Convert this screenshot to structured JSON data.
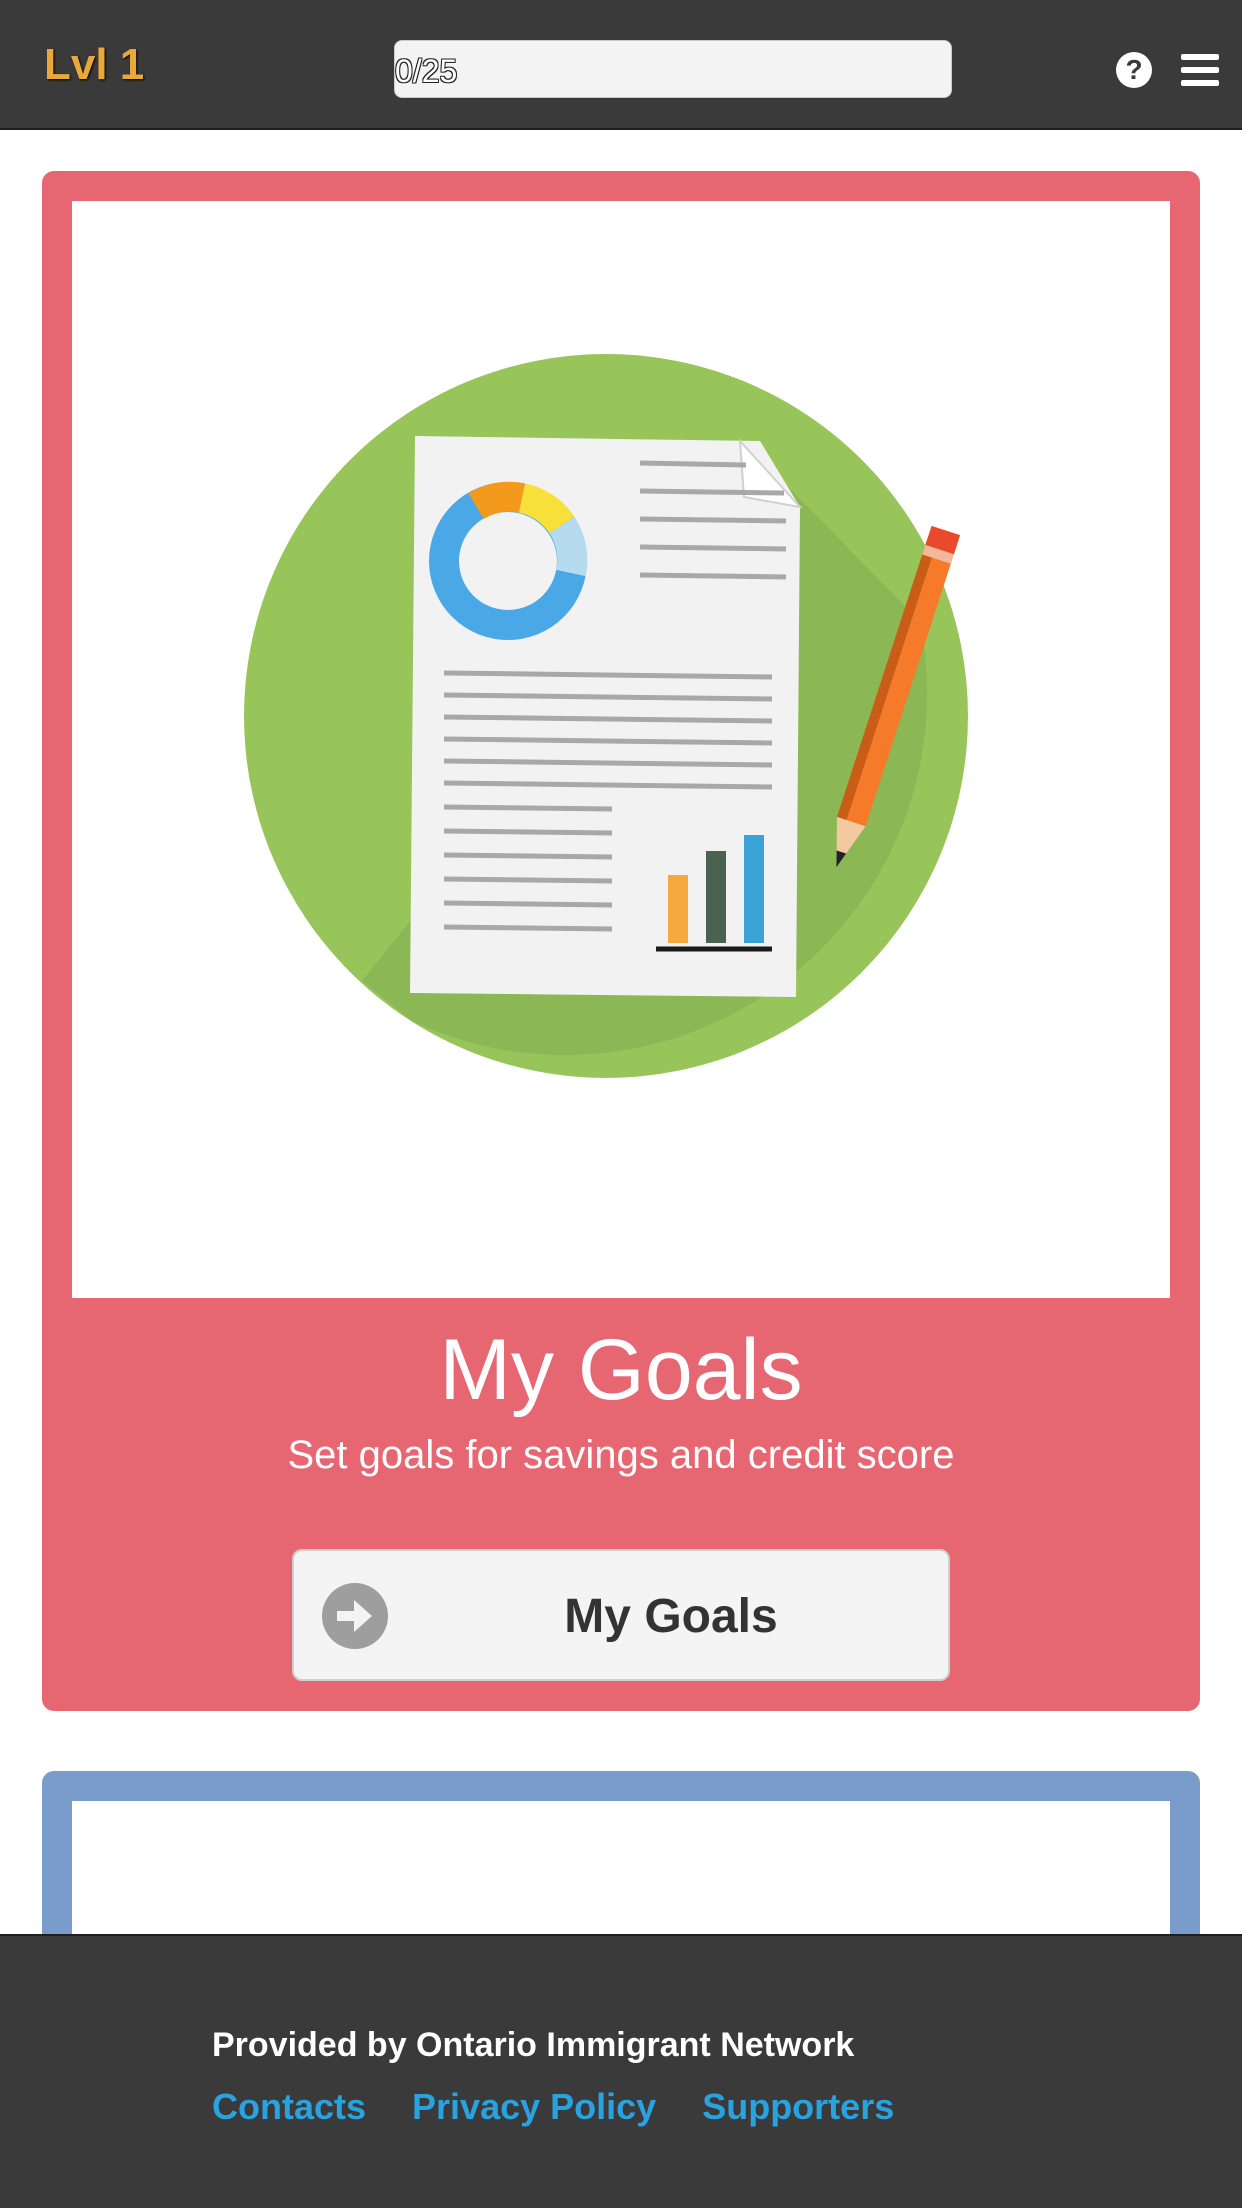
{
  "header": {
    "level_label": "Lvl 1",
    "progress_text": "0/25",
    "progress": 0,
    "help_icon": "question-circle-icon",
    "menu_icon": "hamburger-menu-icon"
  },
  "cards": [
    {
      "color": "#e66672",
      "illustration": "document-report-illustration",
      "title": "My Goals",
      "subtitle": "Set goals for savings and credit score",
      "button_label": "My Goals",
      "button_icon": "arrow-right-circle-icon"
    },
    {
      "color": "#7a9ccb"
    }
  ],
  "footer": {
    "provided_by": "Provided by Ontario Immigrant Network",
    "links": [
      "Contacts",
      "Privacy Policy",
      "Supporters"
    ],
    "link_color": "#29a3e0"
  }
}
